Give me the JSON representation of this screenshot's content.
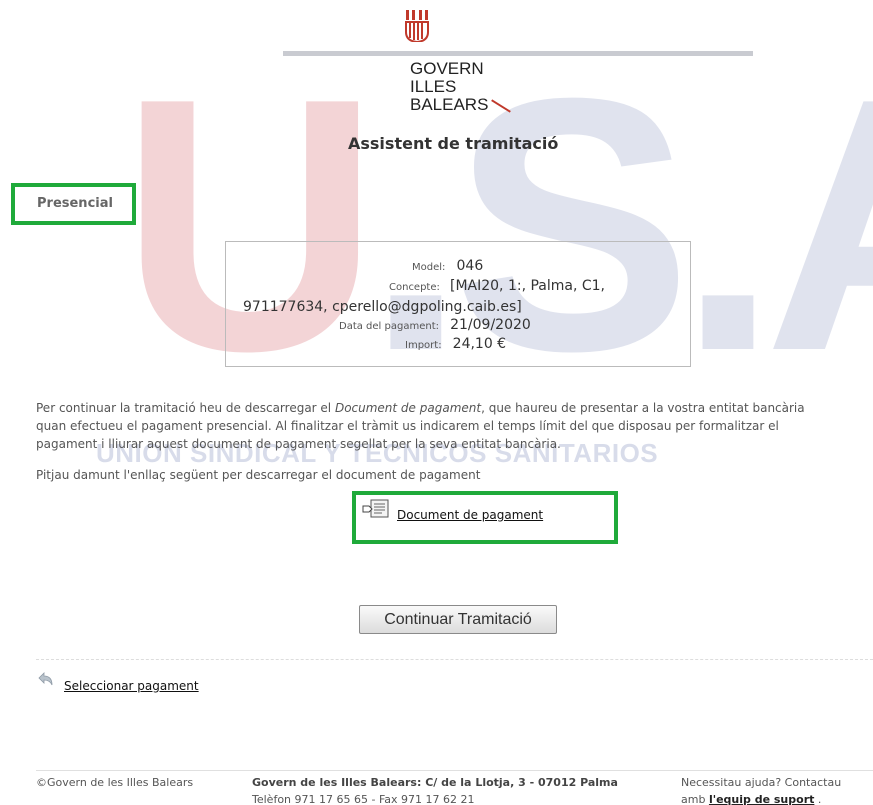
{
  "watermark": {
    "letters": "U.S.A.E",
    "subtitle": "UNION SINDICAL Y TECNICOS SANITARIOS"
  },
  "header": {
    "org_line1": "GOVERN",
    "org_line2": "ILLES",
    "org_line3": "BALEARS",
    "title": "Assistent de tramitació"
  },
  "mode": {
    "label": "Presencial"
  },
  "payment": {
    "model_label": "Model:",
    "model_value": "046",
    "concept_label": "Concepte:",
    "concept_value_line1": "[MAI20, 1:, Palma, C1,",
    "concept_value_line2": "971177634, cperello@dgpoling.caib.es]",
    "date_label": "Data del pagament:",
    "date_value": "21/09/2020",
    "amount_label": "Import:",
    "amount_value": "24,10 €"
  },
  "instructions": {
    "p1_before": "Per continuar la tramitació heu de descarregar el ",
    "p1_em": "Document de pagament",
    "p1_after": ", que haureu de presentar a la vostra entitat bancària quan efectueu el pagament presencial. Al finalitzar el tràmit us indicarem el temps límit del que disposau per formalitzar el pagament i lliurar aquest document de pagament segellat per la seva entitat bancària.",
    "p2": "Pitjau damunt l'enllaç següent per descarregar el document de pagament"
  },
  "download_link": "Document de pagament",
  "continue_button": "Continuar Tramitació",
  "back_link": "Seleccionar pagament",
  "footer": {
    "copyright": "©Govern de les Illes Balears",
    "address": "Govern de les Illes Balears: C/ de la Llotja, 3 - 07012 Palma",
    "phone": "Telèfon 971 17 65 65 - Fax 971 17 62 21",
    "help_line1": "Necessitau ajuda? Contactau",
    "help_prefix": "amb ",
    "help_link": "l'equip de suport",
    "help_suffix": " ."
  },
  "colors": {
    "highlight": "#1faa3a",
    "crest": "#c0392b"
  },
  "icons": [
    "crest-icon",
    "document-icon",
    "back-arrow-icon"
  ]
}
